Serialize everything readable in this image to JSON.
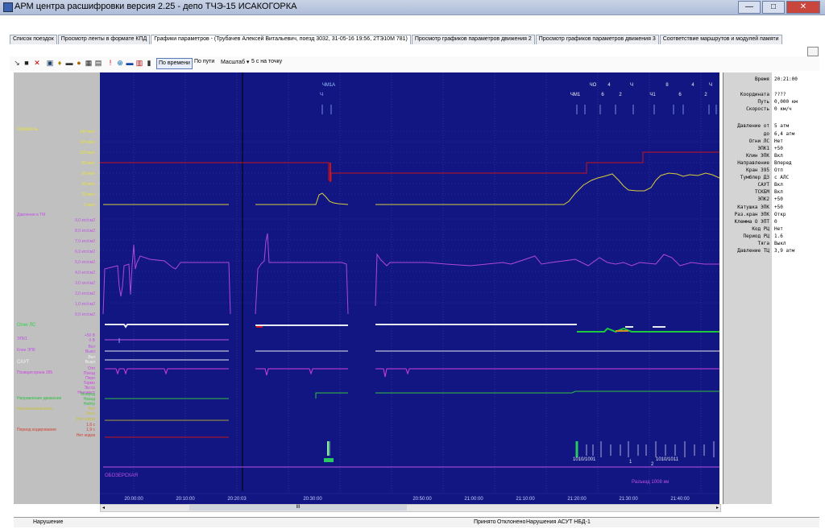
{
  "window": {
    "title": "АРМ центра расшифровки  версия 2.25 - депо ТЧЭ-15 ИСАКОГОРКА",
    "buttons": {
      "minimize": "—",
      "maximize": "□",
      "close": "✕"
    }
  },
  "tabs": [
    {
      "label": "Список поездок"
    },
    {
      "label": "Просмотр ленты в формате КПД"
    },
    {
      "label": "Графики параметров - (Трубачев Алексей Витальевич,  поезд 3032, 31-05-16 19:56, 2ТЭ10М 781)"
    },
    {
      "label": "Просмотр графиков параметров движения 2"
    },
    {
      "label": "Просмотр графиков параметров движения 3"
    },
    {
      "label": "Соответствие маршрутов и модулей памяти"
    }
  ],
  "toolbar": {
    "by_time": "По времени",
    "by_path": "По пути",
    "scale_label": "Масштаб ▾",
    "scale_value": "5 с на точку"
  },
  "left_labels": {
    "speed": "Скорость",
    "speed_ticks": [
      "140 км/ч",
      "120 км/ч",
      "100 км/ч",
      "80 км/ч",
      "60 км/ч",
      "40 км/ч",
      "20 км/ч",
      "0 км/ч"
    ],
    "pressure": "Давление в ТМ",
    "pressure_ticks": [
      "9,0 кгс/см2",
      "8,0 кгс/см2",
      "7,0 кгс/см2",
      "6,0 кгс/см2",
      "5,0 кгс/см2",
      "4,0 кгс/см2",
      "3,0 кгс/см2",
      "2,0 кгс/см2",
      "1,0 кгс/см2",
      "0,0 кгс/см2"
    ],
    "lights": "Огни ЛС",
    "epk1": "ЭПК1",
    "epk1_ticks": [
      "+50 В",
      "0 В"
    ],
    "klim_epk": "Клин ЭПК",
    "klim_ticks": [
      "Вкл",
      "Выкл"
    ],
    "saut": "САУТ",
    "saut_ticks": [
      "Вкл",
      "Выкл"
    ],
    "crane": "Позиция крана 395",
    "crane_ticks": [
      "Отп",
      "Поезд",
      "Пере",
      "Тормо",
      "Экстр",
      "Неизвест"
    ],
    "direction": "Направление движения",
    "direction_ticks": [
      "Вперед",
      "Назад",
      "Нейтр"
    ],
    "lin": "Альсмонтный ключ",
    "lin_ticks": [
      "Вкл",
      "Откл",
      "Нет кодов"
    ],
    "period": "Период кодирования",
    "period_ticks": [
      "1,6 с",
      "1,9 с",
      "Нет кодов"
    ]
  },
  "plot": {
    "station_top": "ЧМ1А",
    "markers_right": [
      "ЧО",
      "4",
      "Ч",
      "8",
      "4",
      "Ч",
      "ЧМ1",
      "6",
      "2",
      "Ч1",
      "6",
      "2"
    ],
    "marker_ch": "Ч",
    "station_name": "ОБОЗЕРСКАЯ",
    "distance_note": "Разъезд 1008 км",
    "km_labels": [
      "1010/1001",
      "1010/1011",
      "1",
      "2"
    ],
    "time_ticks": [
      "20:00:00",
      "20:10:00",
      "20:20:03",
      "20:30:00",
      "20:50:00",
      "21:00:00",
      "21:10:00",
      "21:20:00",
      "21:30:00",
      "21:40:00"
    ],
    "colors": {
      "bg": "#121682",
      "speed": "#d8cc3c",
      "limit": "#c8141a",
      "pressure": "#b048d8",
      "white": "#e8e8f0",
      "green": "#1ec83c",
      "orange": "#d28f28",
      "red": "#c8141a"
    }
  },
  "right_panel": {
    "rows": [
      {
        "label": "Время",
        "value": "20:21:00"
      },
      {
        "label": "Координата",
        "value": "????"
      },
      {
        "label": "Путь",
        "value": "0,000 км"
      },
      {
        "label": "Скорость",
        "value": "0 км/ч"
      },
      {
        "label": "Давление от",
        "value": "5 атм"
      },
      {
        "label": "до",
        "value": "6,4 атм"
      },
      {
        "label": "Огни ЛС",
        "value": "Нет"
      },
      {
        "label": "ЭПК1",
        "value": "+50"
      },
      {
        "label": "Клин ЭПК",
        "value": "Вкл"
      },
      {
        "label": "Направление",
        "value": "Вперед"
      },
      {
        "label": "Кран 395",
        "value": "Отп"
      },
      {
        "label": "Тумблер ДЗ",
        "value": "с АЛС"
      },
      {
        "label": "САУТ",
        "value": "Вкл"
      },
      {
        "label": "ТСКБМ",
        "value": "Вкл"
      },
      {
        "label": "ЭПК2",
        "value": "+50"
      },
      {
        "label": "Катушка ЭПК",
        "value": "+50"
      },
      {
        "label": "Раз.кран ЭПК",
        "value": "Откр"
      },
      {
        "label": "Клемма О ЭПТ",
        "value": "0"
      },
      {
        "label": "Код РЦ",
        "value": "Нет"
      },
      {
        "label": "Период РЦ",
        "value": "1.6"
      },
      {
        "label": "Тяга",
        "value": "Выкл"
      },
      {
        "label": "Давление ТЦ",
        "value": "3,9 атм"
      }
    ]
  },
  "scrollbar": {
    "thumb": "III",
    "left": "◂",
    "right": "▸"
  },
  "status": {
    "violation": "Нарушение",
    "accepted": "Принято",
    "rejected": "Отклонено",
    "asut": "Нарушения АСУТ НБД-1"
  }
}
